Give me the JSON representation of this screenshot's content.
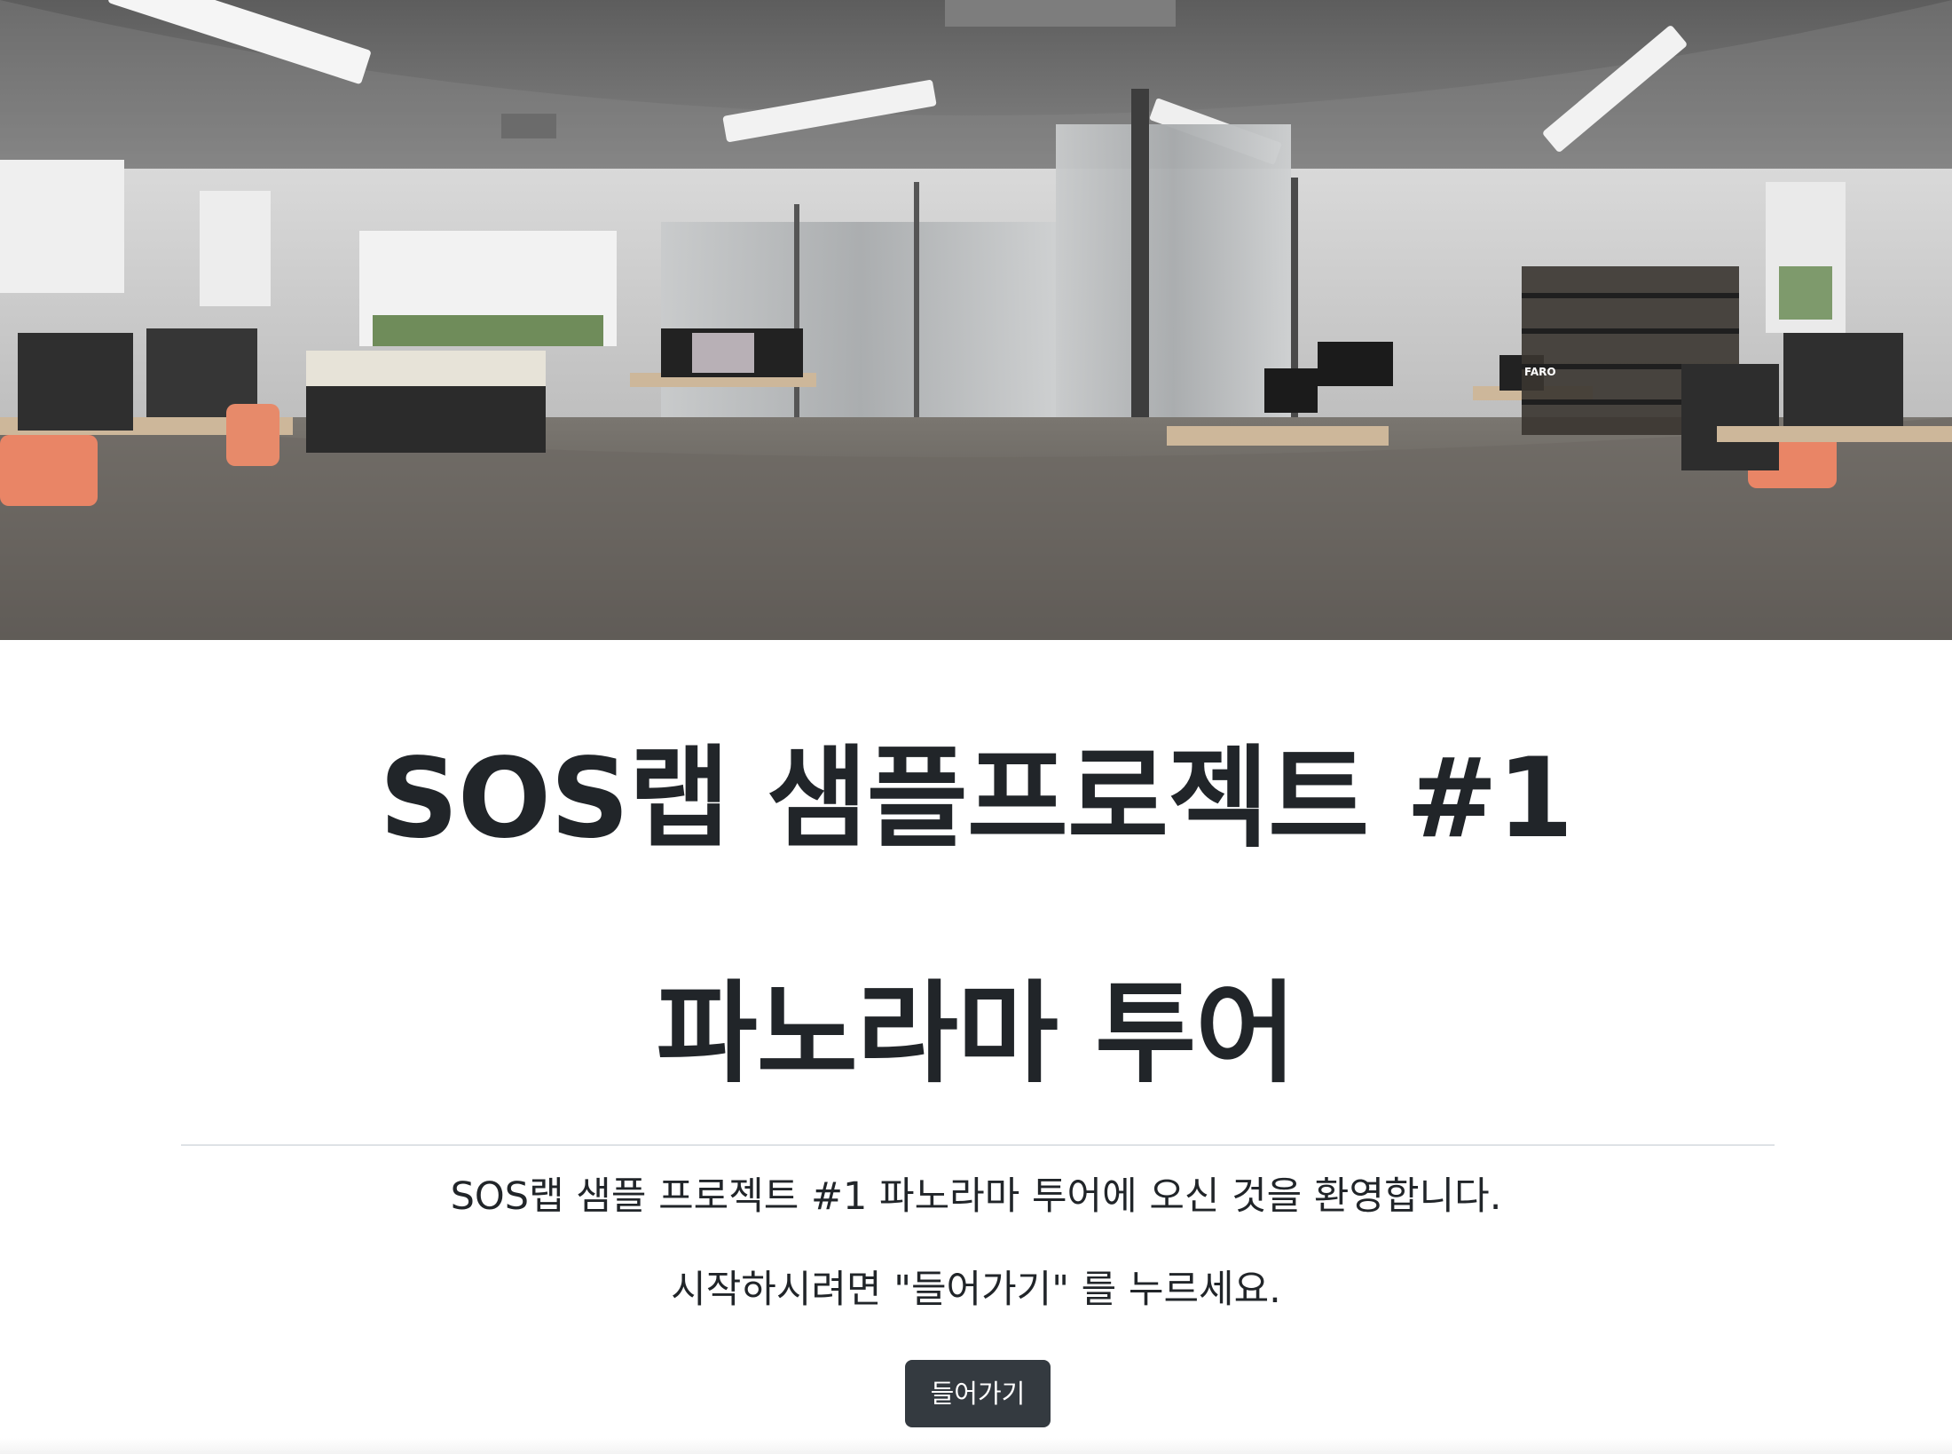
{
  "hero": {
    "image_subject": "360-degree panorama of a lab room with 3D printers, desks, monitors, chairs and glass partitions",
    "overlay_text": "FARO"
  },
  "main": {
    "title_line_1": "SOS랩 샘플프로젝트 #1",
    "title_line_2": "파노라마 투어",
    "lead_line_1": "SOS랩 샘플 프로젝트 #1 파노라마 투어에 오신 것을 환영합니다.",
    "lead_line_2": "시작하시려면 \"들어가기\" 를 누르세요.",
    "enter_button_label": "들어가기"
  },
  "colors": {
    "text": "#212529",
    "button_bg": "#343a40",
    "button_text": "#ffffff",
    "divider": "#dee2e6"
  }
}
